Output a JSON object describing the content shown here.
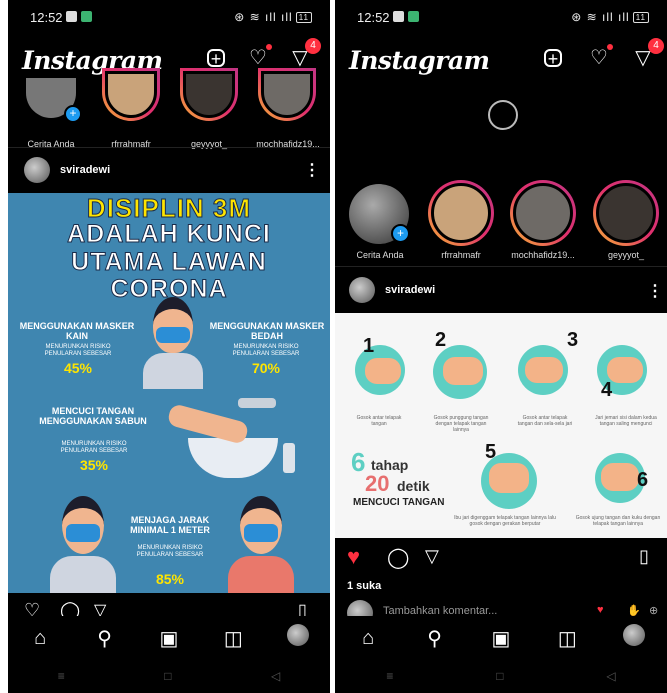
{
  "left_phone": {
    "status": {
      "time": "12:52",
      "battery": "11"
    },
    "app_title": "Instagram",
    "dm_badge": "4",
    "stories": [
      {
        "label": "Cerita Anda"
      },
      {
        "label": "rfrrahmafr"
      },
      {
        "label": "geyyyot_"
      },
      {
        "label": "mochhafidz19..."
      }
    ],
    "post": {
      "username": "sviradewi"
    },
    "poster": {
      "title_line1": "DISIPLIN 3M",
      "title_line2": "ADALAH KUNCI",
      "title_line3": "UTAMA LAWAN",
      "title_line4": "CORONA",
      "item1_title": "MENGGUNAKAN MASKER KAIN",
      "item1_sub": "MENURUNKAN RISIKO PENULARAN SEBESAR",
      "item1_pct": "45%",
      "item2_title": "MENGGUNAKAN MASKER BEDAH",
      "item2_sub": "MENURUNKAN RISIKO PENULARAN SEBESAR",
      "item2_pct": "70%",
      "item3_title": "MENCUCI TANGAN MENGGUNAKAN SABUN",
      "item3_sub": "MENURUNKAN RISIKO PENULARAN SEBESAR",
      "item3_pct": "35%",
      "item4_title": "MENJAGA JARAK MINIMAL 1 METER",
      "item4_sub": "MENURUNKAN RISIKO PENULARAN SEBESAR",
      "item4_pct": "85%"
    }
  },
  "right_phone": {
    "status": {
      "time": "12:52",
      "battery": "11"
    },
    "app_title": "Instagram",
    "dm_badge": "4",
    "stories": [
      {
        "label": "Cerita Anda"
      },
      {
        "label": "rfrrahmafr"
      },
      {
        "label": "mochhafidz19..."
      },
      {
        "label": "geyyyot_"
      }
    ],
    "post": {
      "username": "sviradewi",
      "likes": "1 suka",
      "comment_placeholder": "Tambahkan komentar..."
    },
    "poster": {
      "steps": [
        "1",
        "2",
        "3",
        "4",
        "5",
        "6"
      ],
      "caption_1": "Gosok antar telapak tangan",
      "caption_2": "Gosok punggung tangan dengan telapak tangan lainnya",
      "caption_3": "Gosok antar telapak tangan dan sela-sela jari",
      "caption_4": "Jari jemari sisi dalam kedua tangan saling mengunci",
      "caption_5": "Ibu jari digenggam telapak tangan lainnya lalu gosok dengan gerakan berputar",
      "caption_6": "Gosok ujung tangan dan kuku dengan telapak tangan lainnya",
      "title_num1": "6",
      "title_word1": "tahap",
      "title_num2": "20",
      "title_word2": "detik",
      "title_sub": "MENCUCI TANGAN"
    }
  },
  "colors": {
    "accent_red": "#ff3040",
    "poster_blue": "#3f86b0",
    "poster_yellow": "#ffe500",
    "teal": "#5dcfc3"
  }
}
